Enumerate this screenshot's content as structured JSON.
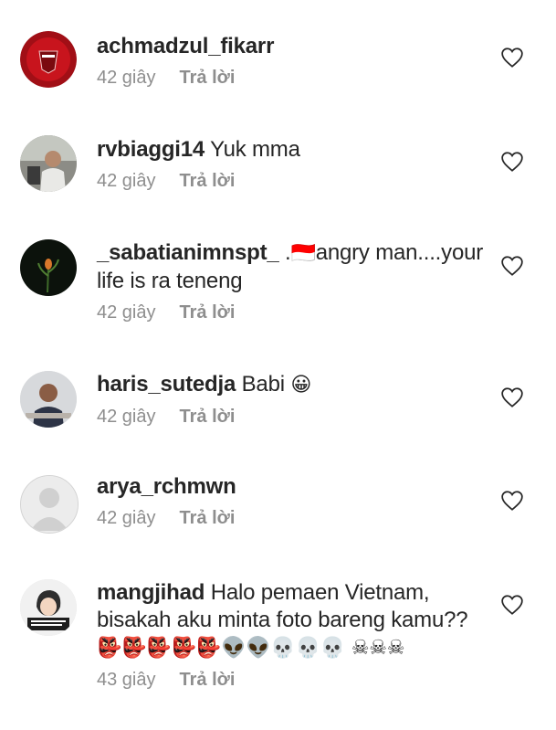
{
  "comments": [
    {
      "username": "achmadzul_fikarr",
      "text": "",
      "time": "42 giây",
      "reply": "Trả lời",
      "avatar": "psm-logo-avatar"
    },
    {
      "username": "rvbiaggi14",
      "text": "Yuk mma",
      "time": "42 giây",
      "reply": "Trả lời",
      "avatar": "person-avatar"
    },
    {
      "username": "_sabatianimnspt_",
      "text_part1": ".",
      "flag": "🇮🇩",
      "text_part2": "angry man....your life is ra teneng",
      "time": "42 giây",
      "reply": "Trả lời",
      "avatar": "dark-plant-avatar"
    },
    {
      "username": "haris_sutedja",
      "text": "Babi",
      "emoji": "😀",
      "time": "42 giây",
      "reply": "Trả lời",
      "avatar": "person-avatar"
    },
    {
      "username": "arya_rchmwn",
      "text": "",
      "time": "42 giây",
      "reply": "Trả lời",
      "avatar": "default-avatar"
    },
    {
      "username": "mangjihad",
      "text": "Halo pemaen Vietnam, bisakah aku minta foto bareng kamu??",
      "emoji": "👺👺👺👺👺👽👽💀💀💀 ☠☠☠",
      "time": "43 giây",
      "reply": "Trả lời",
      "avatar": "cartoon-avatar"
    }
  ],
  "colors": {
    "text": "#262626",
    "meta": "#8e8e8e",
    "avatar_red": "#b3121b"
  }
}
